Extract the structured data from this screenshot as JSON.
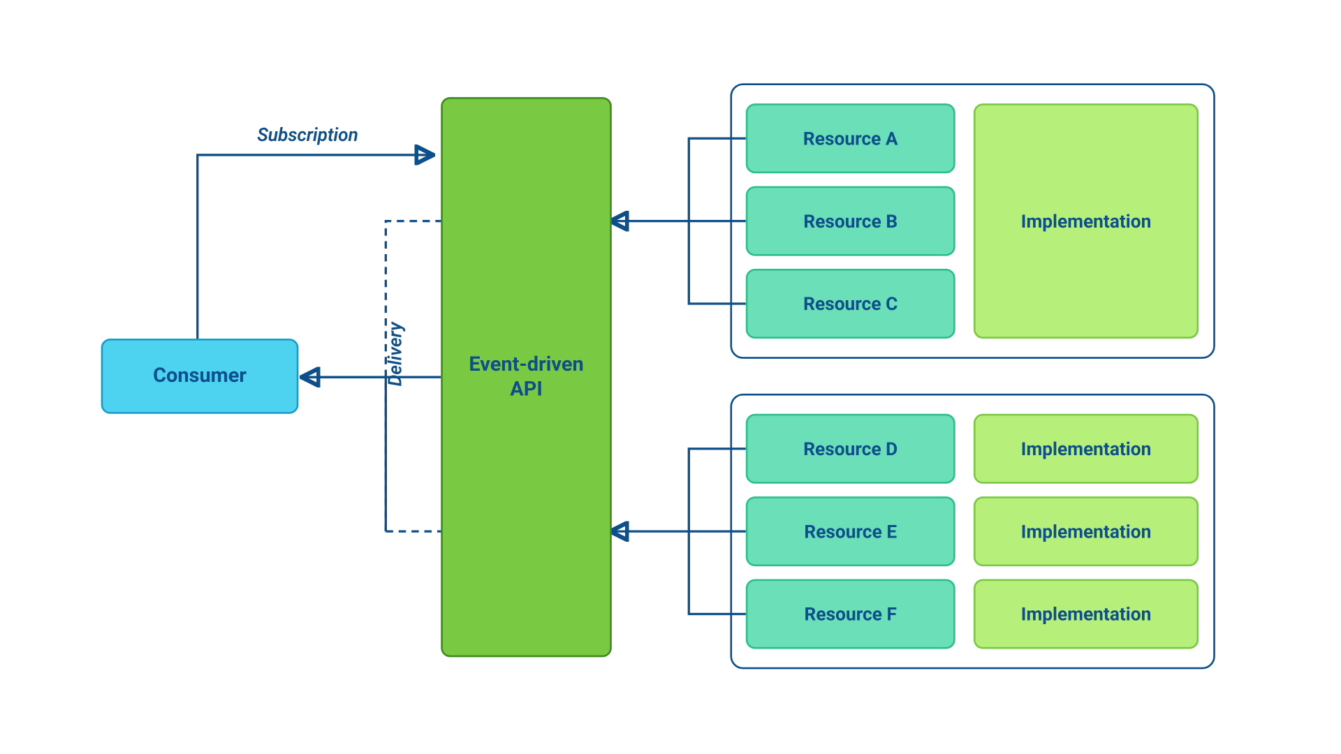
{
  "consumer": {
    "label": "Consumer"
  },
  "api": {
    "label": "Event-driven\nAPI"
  },
  "edges": {
    "subscription": "Subscription",
    "delivery": "Delivery"
  },
  "group1": {
    "resources": [
      "Resource A",
      "Resource B",
      "Resource C"
    ],
    "implementations": [
      "Implementation"
    ]
  },
  "group2": {
    "resources": [
      "Resource D",
      "Resource E",
      "Resource F"
    ],
    "implementations": [
      "Implementation",
      "Implementation",
      "Implementation"
    ]
  },
  "colors": {
    "line": "#0d4f8b",
    "consumer_fill": "#4dd2f0",
    "api_fill": "#7ac943",
    "resource_fill": "#6be0b8",
    "impl_fill": "#b6f07a"
  }
}
